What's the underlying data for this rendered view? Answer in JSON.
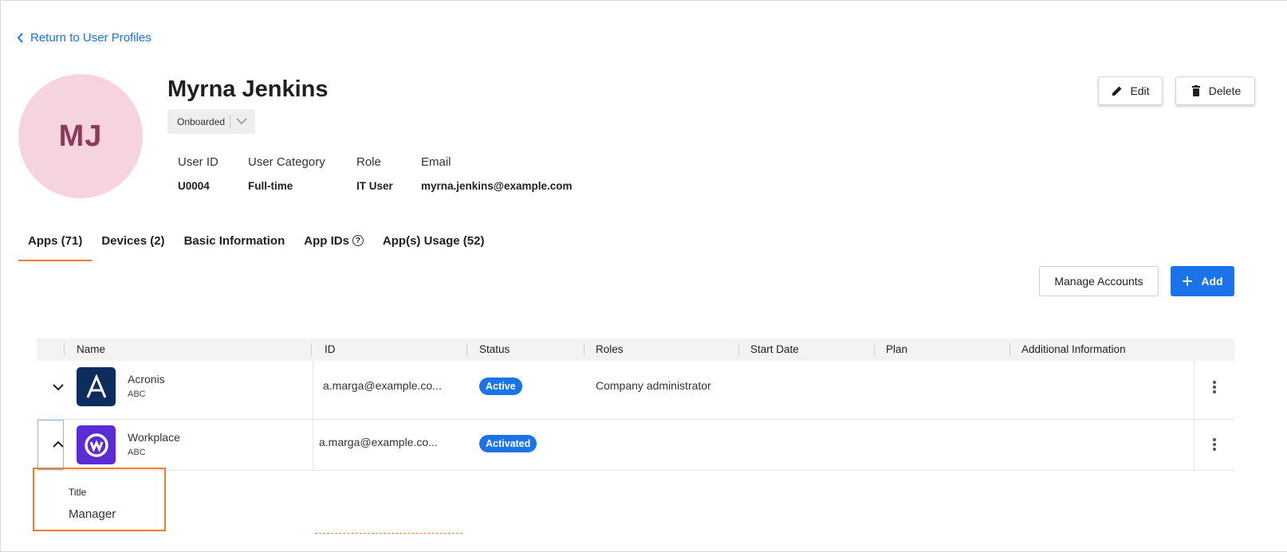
{
  "back_link": "Return to User Profiles",
  "user": {
    "initials": "MJ",
    "name": "Myrna Jenkins",
    "status": "Onboarded",
    "fields": [
      {
        "label": "User ID",
        "value": "U0004"
      },
      {
        "label": "User Category",
        "value": "Full-time"
      },
      {
        "label": "Role",
        "value": "IT User"
      },
      {
        "label": "Email",
        "value": "myrna.jenkins@example.com"
      }
    ]
  },
  "actions": {
    "edit": "Edit",
    "delete": "Delete"
  },
  "tabs": [
    {
      "label": "Apps (71)",
      "active": true
    },
    {
      "label": "Devices (2)"
    },
    {
      "label": "Basic Information"
    },
    {
      "label": "App IDs"
    },
    {
      "label": "App(s) Usage (52)"
    }
  ],
  "toolbar": {
    "manage_accounts": "Manage Accounts",
    "add": "Add"
  },
  "table": {
    "columns": [
      "Name",
      "ID",
      "Status",
      "Roles",
      "Start Date",
      "Plan",
      "Additional Information"
    ],
    "rows": [
      {
        "name": "Acronis",
        "org": "ABC",
        "id": "a.marga@example.co...",
        "status": "Active",
        "roles": "Company administrator",
        "start_date": "",
        "plan": "",
        "additional": ""
      },
      {
        "name": "Workplace",
        "org": "ABC",
        "id": "a.marga@example.co...",
        "status": "Activated",
        "roles": "",
        "start_date": "",
        "plan": "",
        "additional": ""
      }
    ]
  },
  "expanded_detail": {
    "label": "Title",
    "value": "Manager"
  },
  "colors": {
    "accent": "#1a73e8",
    "tab_indicator": "#f07b2a",
    "avatar_bg": "#f5d4de",
    "avatar_text": "#8b3a57",
    "acronis": "#0d2d5e",
    "workplace": "#5b2bd6"
  },
  "icons": [
    "chevron-left-icon",
    "chevron-down-icon",
    "pencil-icon",
    "trash-icon",
    "help-circle-icon",
    "plus-icon",
    "chevron-up-icon",
    "more-vertical-icon"
  ]
}
